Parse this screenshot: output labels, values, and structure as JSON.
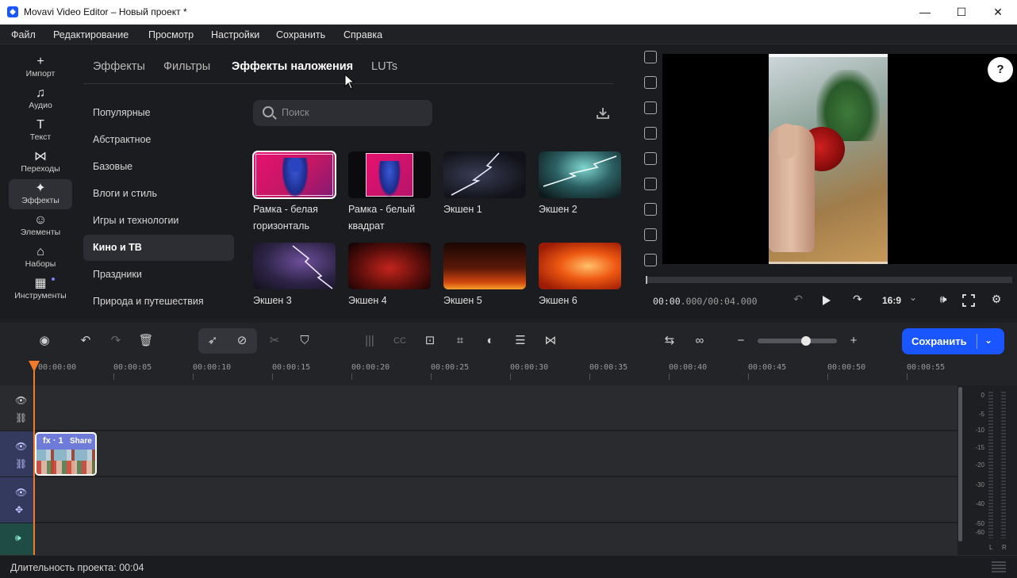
{
  "window": {
    "title": "Movavi Video Editor – Новый проект *",
    "controls": {
      "minimize": "—",
      "maximize": "☐",
      "close": "✕"
    }
  },
  "menu": [
    "Файл",
    "Редактирование",
    "Просмотр",
    "Настройки",
    "Сохранить",
    "Справка"
  ],
  "sidebar": {
    "items": [
      {
        "label": "Импорт",
        "icon": "plus-icon",
        "glyph": "+"
      },
      {
        "label": "Аудио",
        "icon": "music-note-icon",
        "glyph": "♫"
      },
      {
        "label": "Текст",
        "icon": "text-icon",
        "glyph": "T"
      },
      {
        "label": "Переходы",
        "icon": "transitions-icon",
        "glyph": "⋈"
      },
      {
        "label": "Эффекты",
        "icon": "effects-sparkle-icon",
        "glyph": "✦",
        "active": true
      },
      {
        "label": "Элементы",
        "icon": "smiley-icon",
        "glyph": "☺"
      },
      {
        "label": "Наборы",
        "icon": "bag-icon",
        "glyph": "⌂"
      },
      {
        "label": "Инструменты",
        "icon": "tools-grid-icon",
        "glyph": "▦"
      }
    ]
  },
  "effects_panel": {
    "tabs": [
      "Эффекты",
      "Фильтры",
      "Эффекты наложения",
      "LUTs"
    ],
    "active_tab": "Эффекты наложения",
    "categories": [
      "Популярные",
      "Абстрактное",
      "Базовые",
      "Влоги и стиль",
      "Игры и технологии",
      "Кино и ТВ",
      "Праздники",
      "Природа и путешествия"
    ],
    "active_category": "Кино и ТВ",
    "search": {
      "placeholder": "Поиск",
      "value": ""
    },
    "items": [
      {
        "label": "Рамка - белая горизонталь",
        "selected": true
      },
      {
        "label": "Рамка - белый квадрат"
      },
      {
        "label": "Экшен 1"
      },
      {
        "label": "Экшен 2"
      },
      {
        "label": "Экшен 3"
      },
      {
        "label": "Экшен 4"
      },
      {
        "label": "Экшен 5"
      },
      {
        "label": "Экшен 6"
      }
    ]
  },
  "preview": {
    "help": "?",
    "time_current": "00:00",
    "time_current_ms": ".000",
    "time_total": "/00:04.000",
    "aspect": "16:9",
    "chevron": "⌄"
  },
  "timeline": {
    "save_label": "Сохранить",
    "ruler": [
      "00:00:00",
      "00:00:05",
      "00:00:10",
      "00:00:15",
      "00:00:20",
      "00:00:25",
      "00:00:30",
      "00:00:35",
      "00:00:40",
      "00:00:45",
      "00:00:50",
      "00:00:55"
    ],
    "clip": {
      "fx": "fx · 1",
      "name": "Share"
    },
    "meter_db": [
      "0",
      "-5",
      "-10",
      "-15",
      "-20",
      "-30",
      "-40",
      "-50",
      "-60"
    ],
    "meter_channels": [
      "L",
      "R"
    ]
  },
  "status": {
    "duration": "Длительность проекта: 00:04"
  },
  "colors": {
    "accent": "#1a56ff",
    "playhead": "#f07a2c",
    "clip": "#6f7bd8"
  }
}
